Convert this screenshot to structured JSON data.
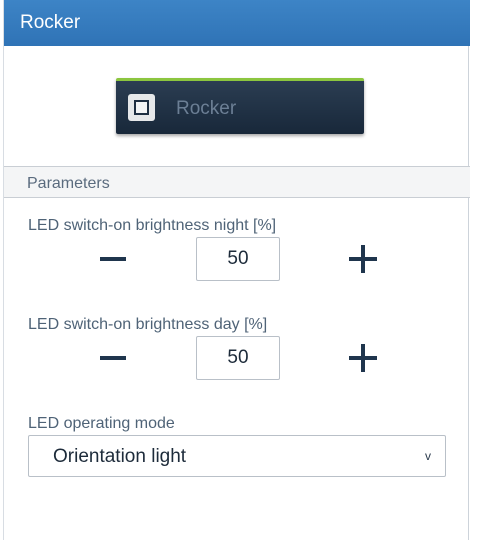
{
  "panel": {
    "title": "Rocker"
  },
  "device": {
    "label": "Rocker",
    "icon": "rocker-switch-icon",
    "accent_color": "#8cc63f",
    "button_color": "#1f3147"
  },
  "parameters": {
    "section_label": "Parameters",
    "night_brightness": {
      "label": "LED switch-on brightness night [%]",
      "value": "50"
    },
    "day_brightness": {
      "label": "LED switch-on brightness day [%]",
      "value": "50"
    },
    "operating_mode": {
      "label": "LED operating mode",
      "selected": "Orientation light",
      "chevron": "v"
    }
  },
  "colors": {
    "header_blue": "#3179bd",
    "text_muted": "#4f6377",
    "icon_dark": "#1f354d"
  }
}
